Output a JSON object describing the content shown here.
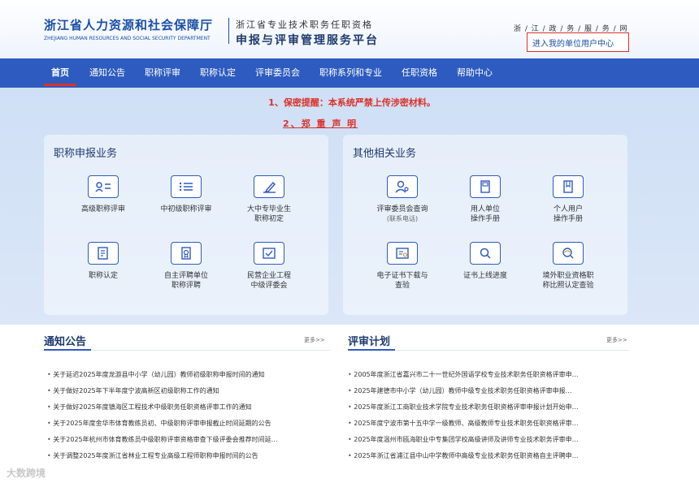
{
  "header": {
    "dept_cn": "浙江省人力资源和社会保障厅",
    "dept_en": "ZHEJIANG HUMAN RESOURCES AND SOCIAL SECURITY DEPARTMENT",
    "platform_sub": "浙江省专业技术职务任职资格",
    "platform_main": "申报与评审管理服务平台",
    "gov_link": "浙 / 江 / 政 / 务 / 服 / 务 / 网",
    "user_center_link": "进入我的单位用户中心"
  },
  "nav": {
    "items": [
      "首页",
      "通知公告",
      "职称评审",
      "职称认定",
      "评审委员会",
      "职称系列和专业",
      "任职资格",
      "帮助中心"
    ]
  },
  "notices": {
    "line1": "1、保密提醒：本系统严禁上传涉密材料。",
    "line2": "2、郑 重 声 明"
  },
  "left_panel": {
    "title": "职称申报业务",
    "items": [
      {
        "label": "高级职称评审",
        "icon": "person-card-icon"
      },
      {
        "label": "中初级职称评审",
        "icon": "list-icon"
      },
      {
        "label": "大中专毕业生",
        "label2": "职称初定",
        "icon": "pen-icon"
      },
      {
        "label": "职称认定",
        "icon": "document-icon"
      },
      {
        "label": "自主评聘单位",
        "label2": "职称评聘",
        "icon": "certificate-icon"
      },
      {
        "label": "民营企业工程",
        "label2": "中级评委会",
        "icon": "check-document-icon"
      }
    ]
  },
  "right_panel": {
    "title": "其他相关业务",
    "items": [
      {
        "label": "评审委员会查询",
        "sub": "(联系电话)",
        "icon": "person-search-icon"
      },
      {
        "label": "用人单位",
        "label2": "操作手册",
        "icon": "manual-icon"
      },
      {
        "label": "个人用户",
        "label2": "操作手册",
        "icon": "bookmark-icon"
      },
      {
        "label": "电子证书下载与",
        "label2": "查验",
        "icon": "certificate-download-icon"
      },
      {
        "label": "证书上线进度",
        "icon": "search-icon"
      },
      {
        "label": "境外职业资格职",
        "label2": "称比照认定查验",
        "icon": "globe-search-icon"
      }
    ]
  },
  "notice_section": {
    "title": "通知公告",
    "more": "更多>>",
    "items": [
      "关于延迟2025年度龙游县中小学（幼儿园）教师初级职称申报时间的通知",
      "关于做好2025年下半年度宁波高新区初级职称工作的通知",
      "关于做好2025年度镇海区工程技术中级职务任职资格评审工作的通知",
      "关于2025年度金华市体育教练员初、中级职称评审申报截止时间延期的公告",
      "关于2025年杭州市体育教练员中级职称评审资格审查下级评委会推荐时间延…",
      "关于调整2025年度浙江省林业工程专业高级工程师职称申报时间的公告"
    ]
  },
  "plan_section": {
    "title": "评审计划",
    "more": "更多>>",
    "items": [
      "2005年度浙江省嘉兴市二十一世纪外国语学校专业技术职务任职资格评审申…",
      "2025年建德市中小学（幼儿园）教师中级专业技术职务任职资格评审申报…",
      "2025年度浙江工商职业技术学院专业技术职务任职资格评审申报计划开始申…",
      "2025年度宁波市第十五中学一级教师、高级教师专业技术职务任职资格评审…",
      "2025年度温州市瓯海职业中专集团学校高级讲师及讲师专业技术职务评审申…",
      "2025年浙江省浦江县中山中学教师中高级专业技术职务任职资格自主评聘申…"
    ]
  },
  "watermark": "大数跨境",
  "colors": {
    "brand_blue": "#2e5bbf",
    "dark_blue": "#1e3a6e",
    "alert_red": "#d9322a"
  }
}
